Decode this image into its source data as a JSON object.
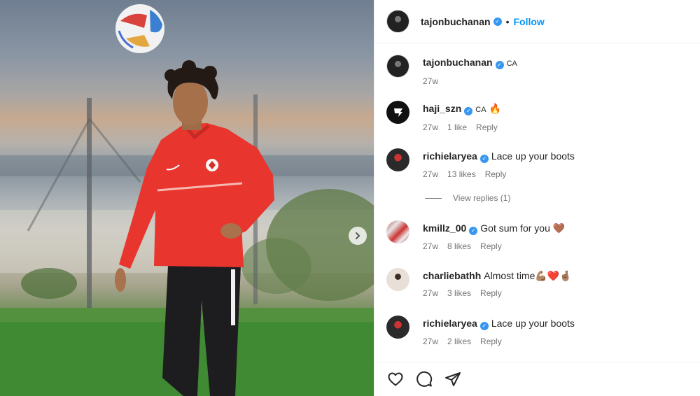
{
  "post": {
    "author": "tajonbuchanan",
    "follow_label": "Follow",
    "separator": "•"
  },
  "comments": [
    {
      "username": "tajonbuchanan",
      "text": "",
      "flag": "CA",
      "age": "27w",
      "likes": "",
      "reply": ""
    },
    {
      "username": "haji_szn",
      "text": "🔥",
      "flag": "CA",
      "age": "27w",
      "likes": "1 like",
      "reply": "Reply"
    },
    {
      "username": "richielaryea",
      "text": "Lace up your boots",
      "flag": "",
      "age": "27w",
      "likes": "13 likes",
      "reply": "Reply"
    },
    {
      "username": "kmillz_00",
      "text": "Got sum for you 🤎",
      "flag": "",
      "age": "27w",
      "likes": "8 likes",
      "reply": "Reply"
    },
    {
      "username": "charliebathh",
      "text": "Almost time💪🏽❤️🤞🏽",
      "flag": "",
      "age": "27w",
      "likes": "3 likes",
      "reply": "Reply"
    },
    {
      "username": "richielaryea",
      "text": "Lace up your boots",
      "flag": "",
      "age": "27w",
      "likes": "2 likes",
      "reply": "Reply"
    }
  ],
  "view_replies_label": "View replies (1)",
  "icons": {
    "like": "heart-icon",
    "comment": "comment-bubble-icon",
    "share": "paper-plane-icon",
    "next": "chevron-right-icon",
    "verified": "verified-badge-icon"
  },
  "colors": {
    "follow": "#0095f6",
    "verified": "#3797f0",
    "jersey": "#e8352e"
  }
}
